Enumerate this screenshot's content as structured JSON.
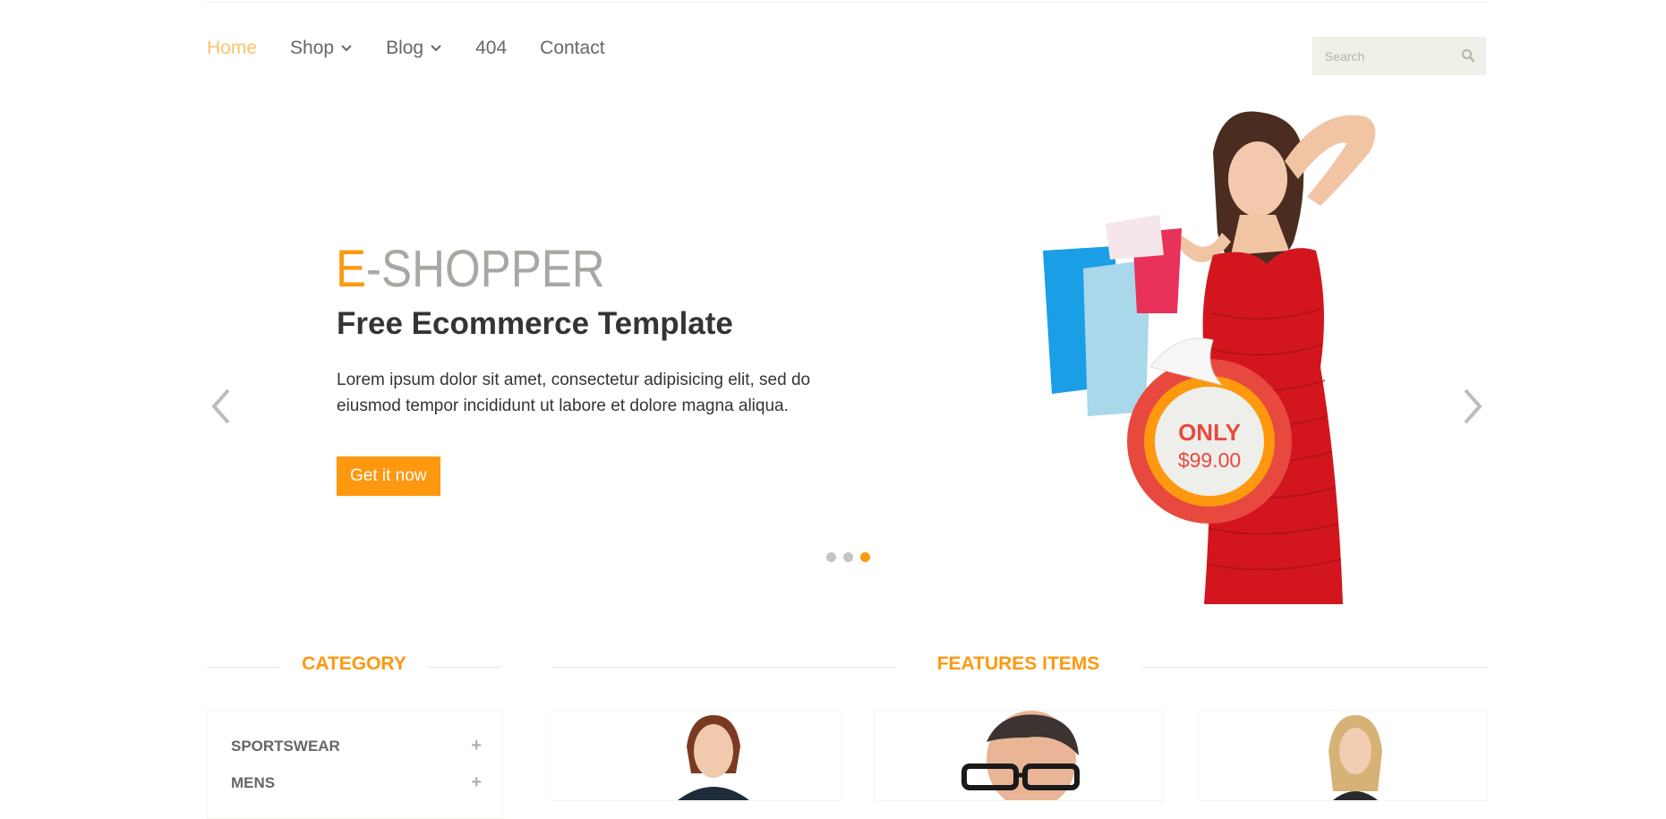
{
  "nav": {
    "items": [
      {
        "label": "Home",
        "active": true,
        "dropdown": false
      },
      {
        "label": "Shop",
        "active": false,
        "dropdown": true
      },
      {
        "label": "Blog",
        "active": false,
        "dropdown": true
      },
      {
        "label": "404",
        "active": false,
        "dropdown": false
      },
      {
        "label": "Contact",
        "active": false,
        "dropdown": false
      }
    ],
    "search_placeholder": "Search",
    "search_icon": "search-icon"
  },
  "slider": {
    "brand_accent": "E",
    "brand_rest": "-SHOPPER",
    "headline": "Free Ecommerce Template",
    "description": "Lorem ipsum dolor sit amet, consectetur adipisicing elit, sed do eiusmod tempor incididunt ut labore et dolore magna aliqua.",
    "cta_label": "Get it now",
    "active_slide": 3,
    "slide_count": 3,
    "price_badge": {
      "line1": "ONLY",
      "line2": "$99.00"
    }
  },
  "sections": {
    "category_title": "CATEGORY",
    "features_title": "FEATURES ITEMS"
  },
  "categories": [
    {
      "label": "SPORTSWEAR"
    },
    {
      "label": "MENS"
    }
  ],
  "colors": {
    "accent": "#FE980F",
    "text": "#696763",
    "dark": "#363432",
    "search_bg": "#F0F0E9"
  }
}
